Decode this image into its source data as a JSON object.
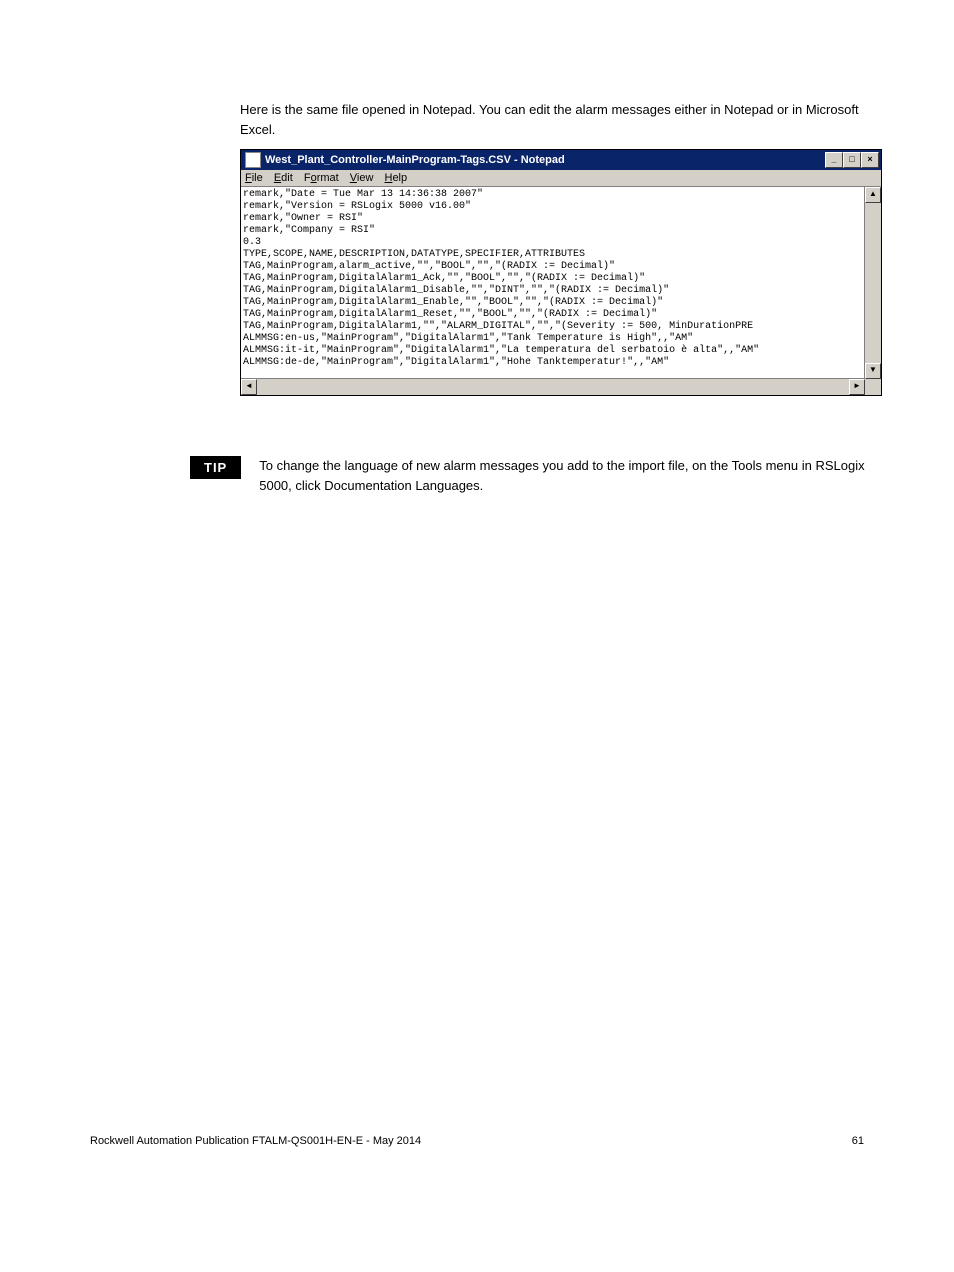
{
  "intro": "Here is the same file opened in Notepad. You can edit the alarm messages either in Notepad or in Microsoft Excel.",
  "window": {
    "title": "West_Plant_Controller-MainProgram-Tags.CSV - Notepad",
    "menus": {
      "file": "File",
      "edit": "Edit",
      "format": "Format",
      "view": "View",
      "help": "Help"
    },
    "content": "remark,\"Date = Tue Mar 13 14:36:38 2007\"\nremark,\"Version = RSLogix 5000 v16.00\"\nremark,\"Owner = RSI\"\nremark,\"Company = RSI\"\n0.3\nTYPE,SCOPE,NAME,DESCRIPTION,DATATYPE,SPECIFIER,ATTRIBUTES\nTAG,MainProgram,alarm_active,\"\",\"BOOL\",\"\",\"(RADIX := Decimal)\"\nTAG,MainProgram,DigitalAlarm1_Ack,\"\",\"BOOL\",\"\",\"(RADIX := Decimal)\"\nTAG,MainProgram,DigitalAlarm1_Disable,\"\",\"DINT\",\"\",\"(RADIX := Decimal)\"\nTAG,MainProgram,DigitalAlarm1_Enable,\"\",\"BOOL\",\"\",\"(RADIX := Decimal)\"\nTAG,MainProgram,DigitalAlarm1_Reset,\"\",\"BOOL\",\"\",\"(RADIX := Decimal)\"\nTAG,MainProgram,DigitalAlarm1,\"\",\"ALARM_DIGITAL\",\"\",\"(Severity := 500, MinDurationPRE\nALMMSG:en-us,\"MainProgram\",\"DigitalAlarm1\",\"Tank Temperature is High\",,\"AM\"\nALMMSG:it-it,\"MainProgram\",\"DigitalAlarm1\",\"La temperatura del serbatoio è alta\",,\"AM\"\nALMMSG:de-de,\"MainProgram\",\"DigitalAlarm1\",\"Hohe Tanktemperatur!\",,\"AM\""
  },
  "tip": {
    "label": "TIP",
    "text": "To change the language of new alarm messages you add to the import file, on the Tools menu in RSLogix 5000, click Documentation Languages."
  },
  "footer": {
    "left": "Rockwell Automation Publication FTALM-QS001H-EN-E - May 2014",
    "right": "61"
  }
}
